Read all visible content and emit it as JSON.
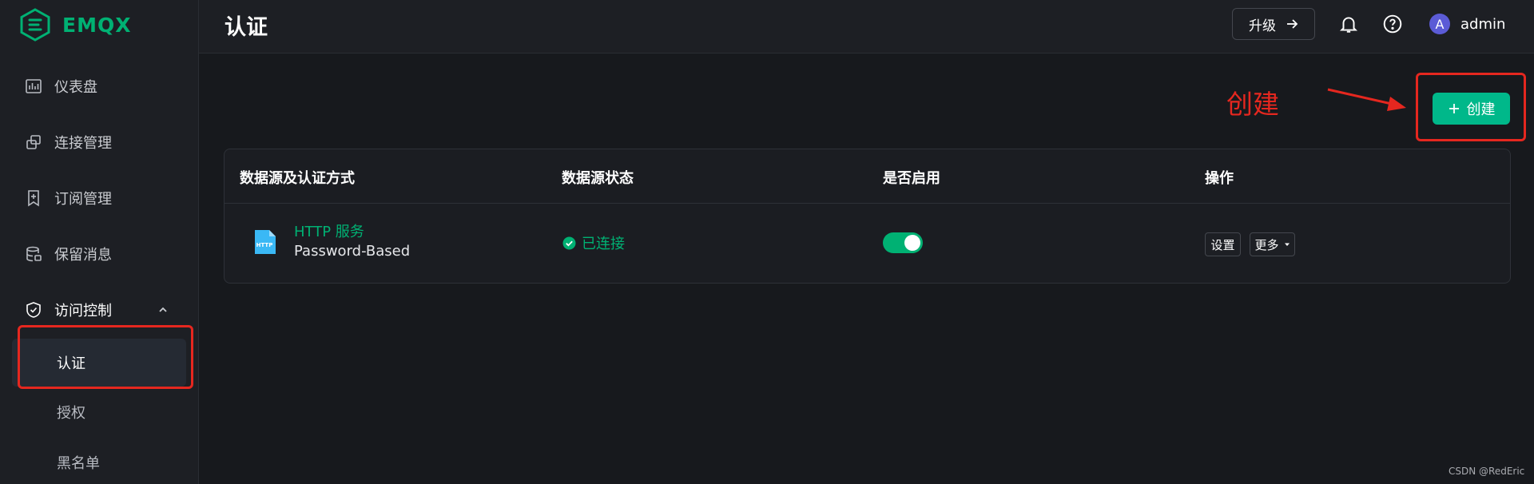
{
  "app": {
    "name": "EMQX"
  },
  "sidebar": {
    "items": [
      {
        "label": "仪表盘",
        "icon": "dashboard-icon"
      },
      {
        "label": "连接管理",
        "icon": "connections-icon"
      },
      {
        "label": "订阅管理",
        "icon": "subscriptions-icon"
      },
      {
        "label": "保留消息",
        "icon": "retained-messages-icon"
      },
      {
        "label": "访问控制",
        "icon": "shield-icon",
        "expanded": true
      }
    ],
    "sub_items": [
      {
        "label": "认证",
        "active": true
      },
      {
        "label": "授权",
        "active": false
      },
      {
        "label": "黑名单",
        "active": false
      }
    ]
  },
  "header": {
    "title": "认证",
    "upgrade_label": "升级",
    "avatar_letter": "A",
    "username": "admin"
  },
  "annotation": {
    "text": "创建",
    "color": "#e5271f"
  },
  "toolbar": {
    "create_label": "创建"
  },
  "table": {
    "columns": [
      "数据源及认证方式",
      "数据源状态",
      "是否启用",
      "操作"
    ],
    "rows": [
      {
        "source_name": "HTTP 服务",
        "icon_label": "HTTP",
        "mechanism": "Password-Based",
        "status": "已连接",
        "enabled": true,
        "actions": {
          "settings": "设置",
          "more": "更多"
        }
      }
    ]
  },
  "watermark": "CSDN @RedEric",
  "colors": {
    "accent": "#00b173",
    "button": "#00b88a",
    "annotation": "#e5271f",
    "background": "#17191d"
  }
}
